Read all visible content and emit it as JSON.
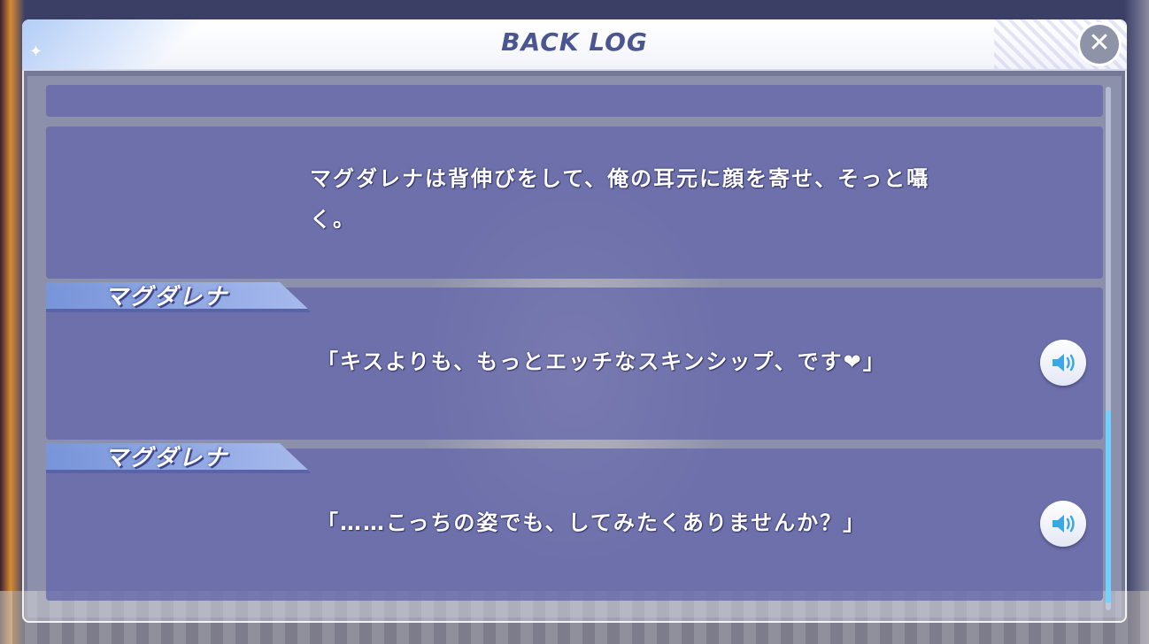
{
  "window": {
    "title": "BACK LOG",
    "close_symbol": "✕",
    "header_deco": "✦"
  },
  "entries": [
    {
      "speaker": "",
      "text": "",
      "has_voice": false
    },
    {
      "speaker": "",
      "line1": "マグダレナは背伸びをして、俺の耳元に顔を寄せ、そっと囁",
      "line2": "く。",
      "has_voice": false
    },
    {
      "speaker": "マグダレナ",
      "text": "「キスよりも、もっとエッチなスキンシップ、です❤」",
      "has_voice": true,
      "voice_icon": "speaker-icon"
    },
    {
      "speaker": "マグダレナ",
      "text": "「……こっちの姿でも、してみたくありませんか？」",
      "has_voice": true,
      "voice_icon": "speaker-icon"
    }
  ],
  "colors": {
    "accent": "#4b5590",
    "entry_bg": "#6466aa",
    "scroll_thumb": "#6fd2ff"
  },
  "scroll": {
    "position_fraction": 0.62
  }
}
